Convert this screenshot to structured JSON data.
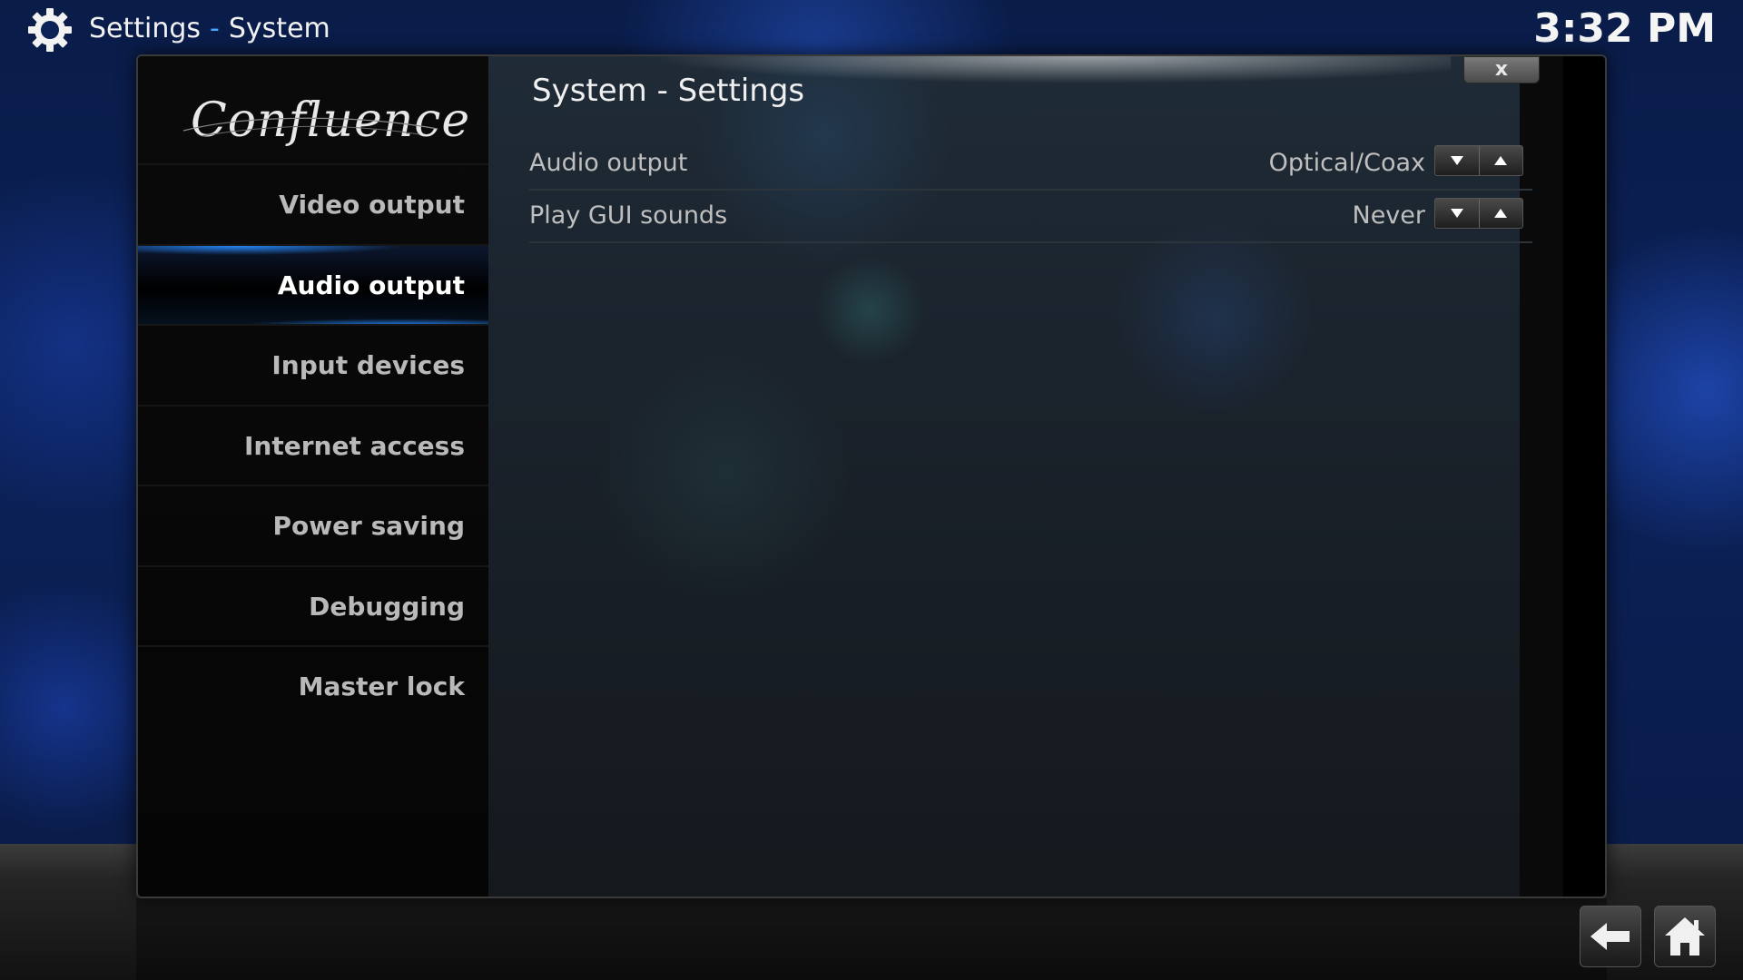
{
  "header": {
    "section": "Settings",
    "separator": "-",
    "subsection": "System",
    "clock": "3:32 PM",
    "icon": "gear-icon"
  },
  "dialog": {
    "logo_text": "Confluence",
    "title": "System - Settings",
    "close_label": "x"
  },
  "sidebar": {
    "active_index": 1,
    "items": [
      {
        "label": "Video output"
      },
      {
        "label": "Audio output"
      },
      {
        "label": "Input devices"
      },
      {
        "label": "Internet access"
      },
      {
        "label": "Power saving"
      },
      {
        "label": "Debugging"
      },
      {
        "label": "Master lock"
      }
    ]
  },
  "settings": [
    {
      "label": "Audio output",
      "value": "Optical/Coax"
    },
    {
      "label": "Play GUI sounds",
      "value": "Never"
    }
  ],
  "footer": {
    "back_icon": "back-arrow-icon",
    "home_icon": "home-icon"
  },
  "colors": {
    "accent": "#2a8cff",
    "background": "#0b2158"
  }
}
